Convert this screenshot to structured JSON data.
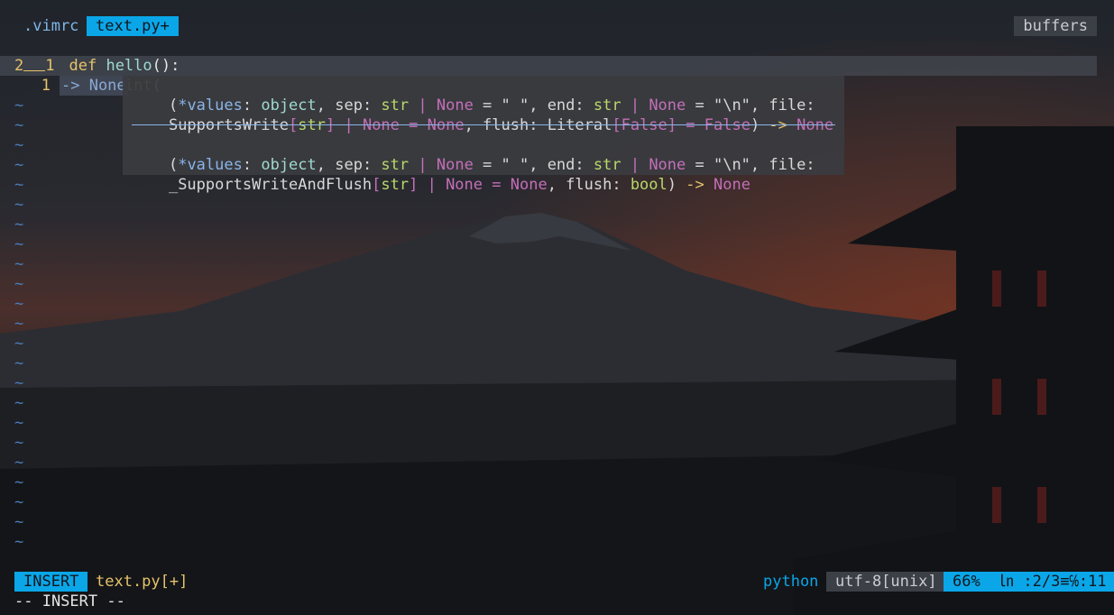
{
  "tabs": [
    {
      "label": ".vimrc",
      "active": false
    },
    {
      "label": "text.py+",
      "active": true
    }
  ],
  "buffers_label": "buffers",
  "code": [
    {
      "num": "1",
      "keyword": "def",
      "name": "hello",
      "rest": "():"
    },
    {
      "num": "2",
      "indent": "    ",
      "builtin": "print",
      "rest": "("
    }
  ],
  "virtual": {
    "num": "1",
    "text": "-> None"
  },
  "signature_popup": {
    "sig1_line1": [
      "(",
      "*values",
      ": ",
      "object",
      ", sep: ",
      "str",
      " | ",
      "None",
      " = \" \", end: ",
      "str",
      " | ",
      "None",
      " = \"\\n\", file:"
    ],
    "sig1_line2": [
      "SupportsWrite",
      "[",
      "str",
      "]",
      " | ",
      "None",
      " = ",
      "None",
      ", flush: Literal",
      "[",
      "False",
      "]",
      " = ",
      "False",
      ") ",
      "->",
      " ",
      "None"
    ],
    "sig2_line1": [
      "(",
      "*values",
      ": ",
      "object",
      ", sep: ",
      "str",
      " | ",
      "None",
      " = \" \", end: ",
      "str",
      " | ",
      "None",
      " = \"\\n\", file:"
    ],
    "sig2_line2": [
      "_SupportsWriteAndFlush",
      "[",
      "str",
      "]",
      " | ",
      "None",
      " = ",
      "None",
      ", flush: ",
      "bool",
      ") ",
      "->",
      " ",
      "None"
    ]
  },
  "tilde_char": "~",
  "statusline": {
    "mode": "INSERT",
    "filename": "text.py[+]",
    "filetype": "python",
    "encoding": "utf-8[unix]",
    "position": "66%  ㏑ :2/3≡℅:11"
  },
  "cmdline": "-- INSERT --",
  "colors": {
    "accent": "#0aa6e8",
    "line_number": "#e5c26b",
    "tilde": "#4b7bb8",
    "popup_bg": "#3a3c40"
  }
}
